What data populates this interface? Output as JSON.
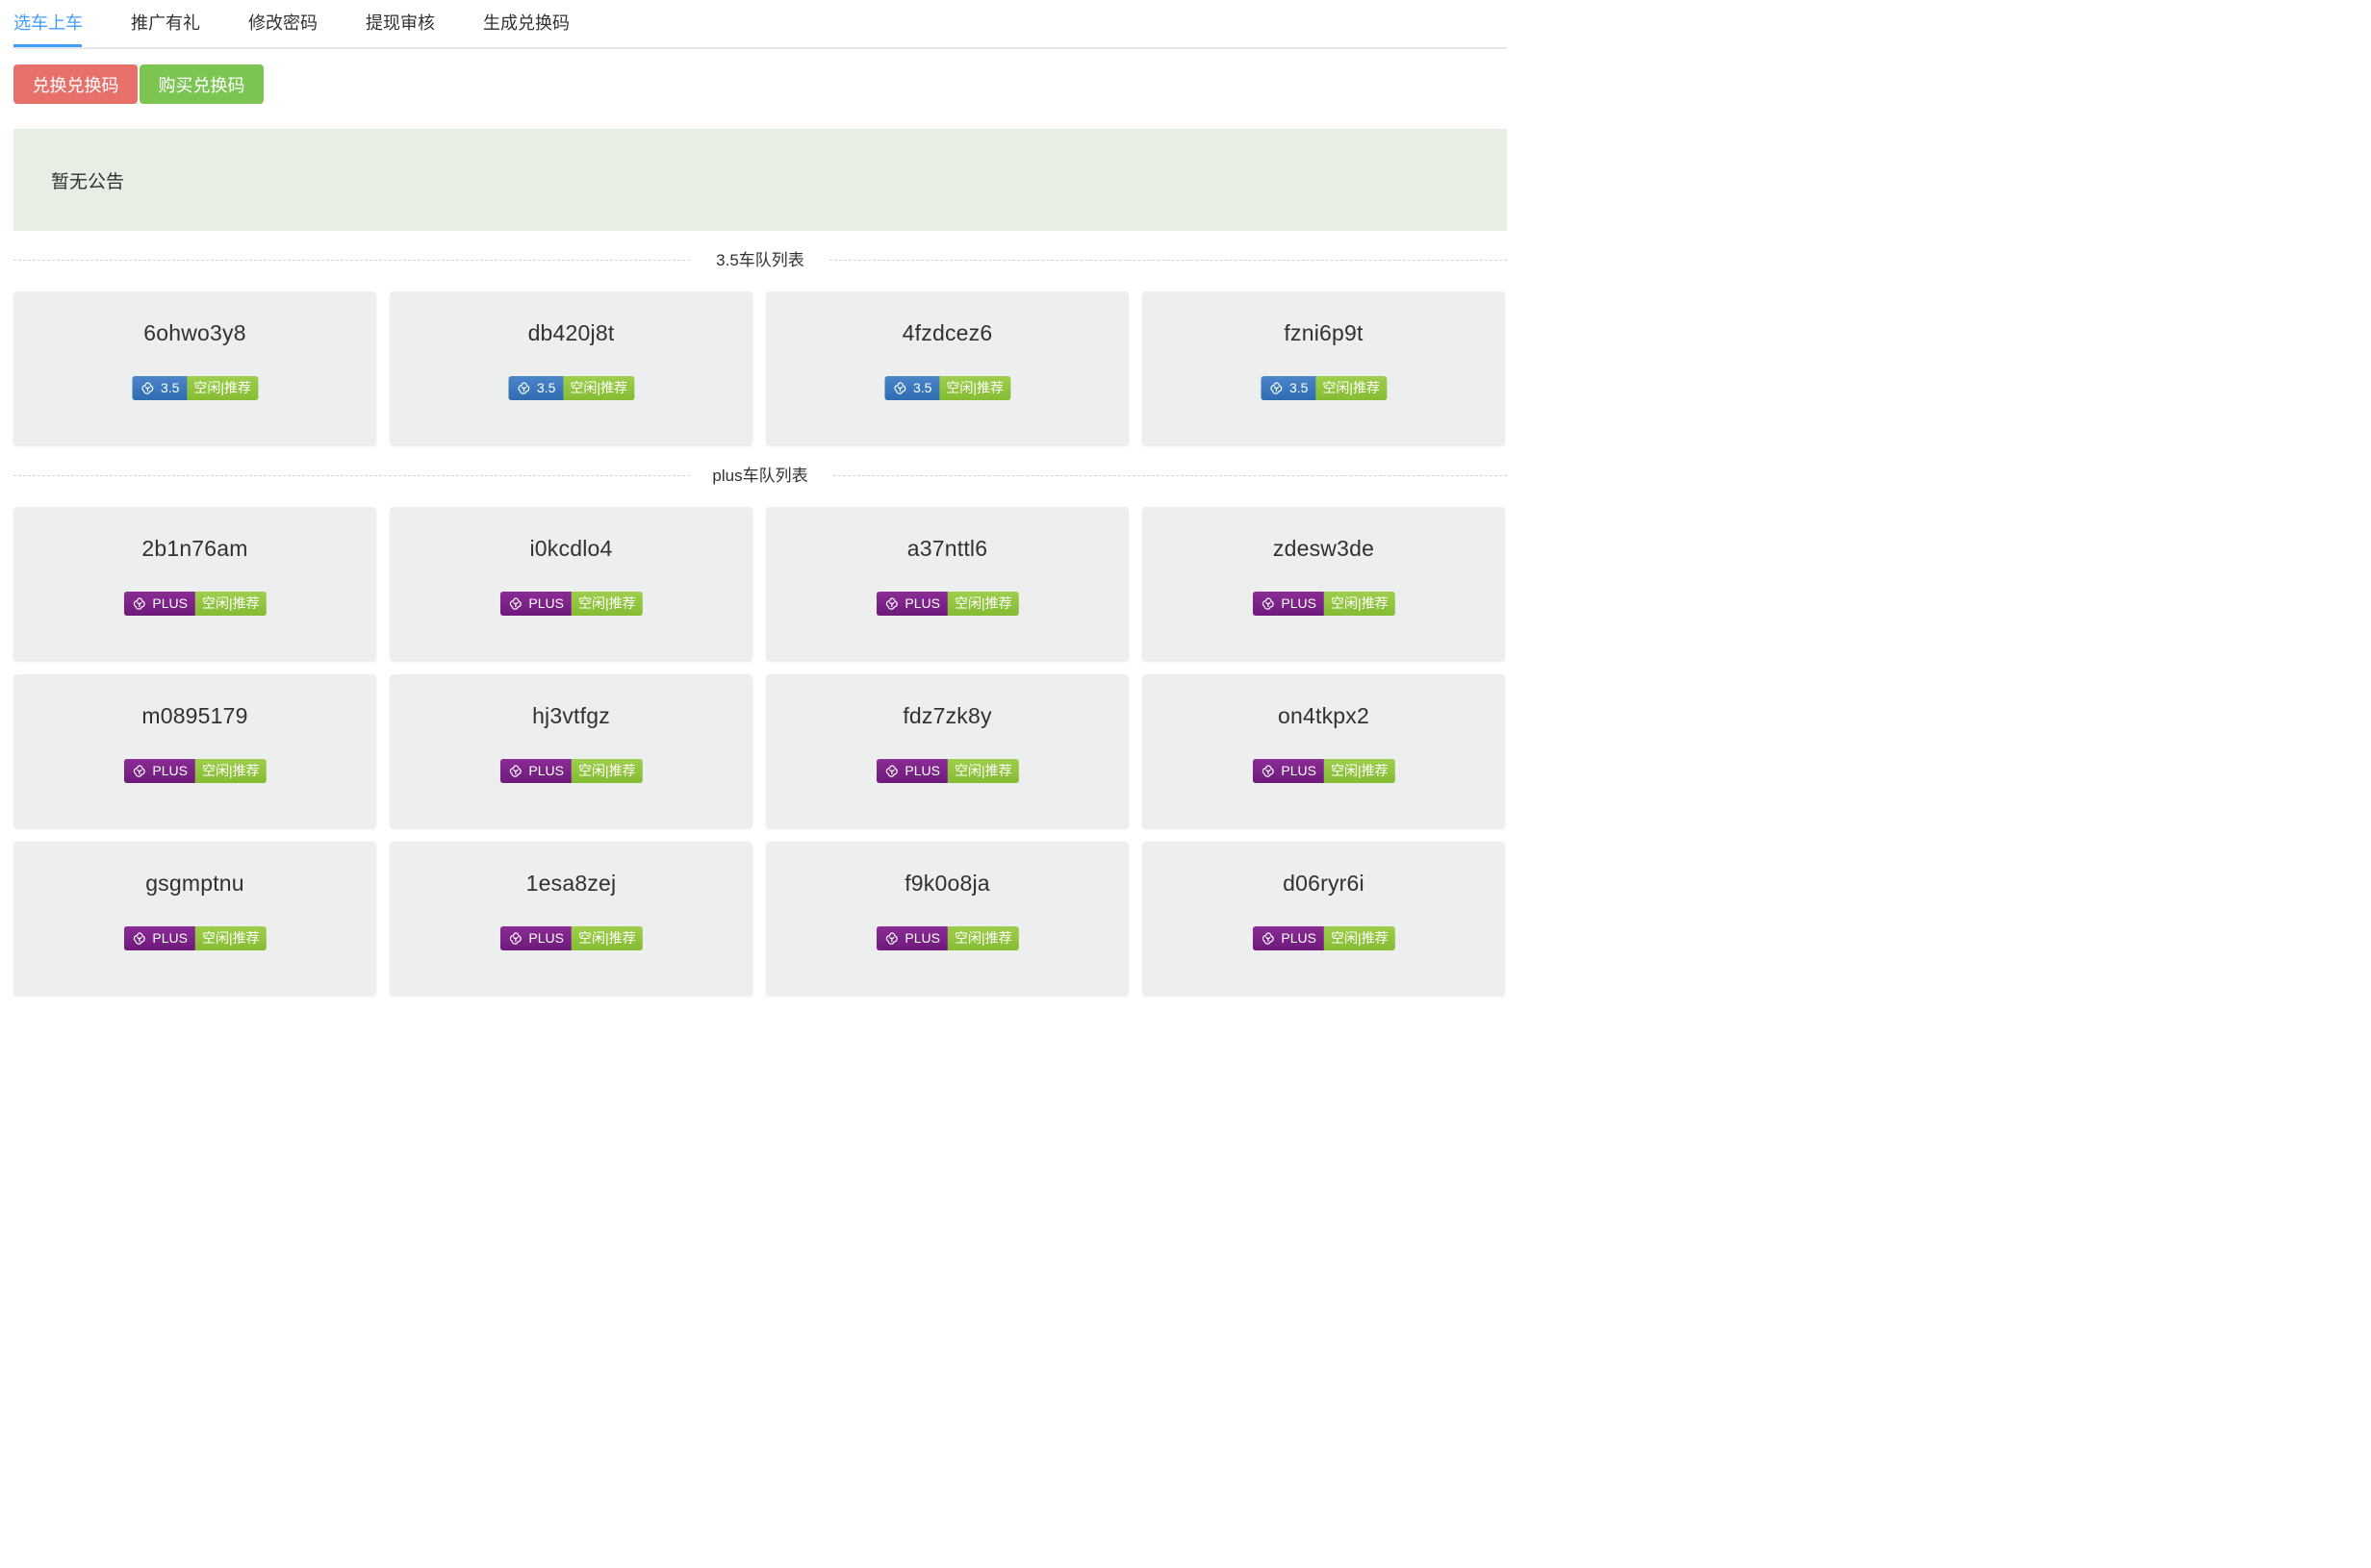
{
  "tabs": [
    "选车上车",
    "推广有礼",
    "修改密码",
    "提现审核",
    "生成兑换码"
  ],
  "buttons": {
    "redeem": "兑换兑换码",
    "buy": "购买兑换码"
  },
  "notice": "暂无公告",
  "colors": {
    "accent": "#409eff",
    "redeem_button": "#e8706b",
    "buy_button": "#7cc552",
    "badge_35": "#3a7abf",
    "badge_plus": "#7b2385",
    "badge_status": "#8dc43d"
  },
  "sections": {
    "gpt35": {
      "title": "3.5车队列表",
      "cards": [
        {
          "name": "6ohwo3y8",
          "model": "3.5",
          "status": "空闲|推荐",
          "icon": "openai-logo-icon"
        },
        {
          "name": "db420j8t",
          "model": "3.5",
          "status": "空闲|推荐",
          "icon": "openai-logo-icon"
        },
        {
          "name": "4fzdcez6",
          "model": "3.5",
          "status": "空闲|推荐",
          "icon": "openai-logo-icon"
        },
        {
          "name": "fzni6p9t",
          "model": "3.5",
          "status": "空闲|推荐",
          "icon": "openai-logo-icon"
        }
      ]
    },
    "plus": {
      "title": "plus车队列表",
      "cards": [
        {
          "name": "2b1n76am",
          "model": "PLUS",
          "status": "空闲|推荐",
          "icon": "openai-logo-icon"
        },
        {
          "name": "i0kcdlo4",
          "model": "PLUS",
          "status": "空闲|推荐",
          "icon": "openai-logo-icon"
        },
        {
          "name": "a37nttl6",
          "model": "PLUS",
          "status": "空闲|推荐",
          "icon": "openai-logo-icon"
        },
        {
          "name": "zdesw3de",
          "model": "PLUS",
          "status": "空闲|推荐",
          "icon": "openai-logo-icon"
        },
        {
          "name": "m0895179",
          "model": "PLUS",
          "status": "空闲|推荐",
          "icon": "openai-logo-icon"
        },
        {
          "name": "hj3vtfgz",
          "model": "PLUS",
          "status": "空闲|推荐",
          "icon": "openai-logo-icon"
        },
        {
          "name": "fdz7zk8y",
          "model": "PLUS",
          "status": "空闲|推荐",
          "icon": "openai-logo-icon"
        },
        {
          "name": "on4tkpx2",
          "model": "PLUS",
          "status": "空闲|推荐",
          "icon": "openai-logo-icon"
        },
        {
          "name": "gsgmptnu",
          "model": "PLUS",
          "status": "空闲|推荐",
          "icon": "openai-logo-icon"
        },
        {
          "name": "1esa8zej",
          "model": "PLUS",
          "status": "空闲|推荐",
          "icon": "openai-logo-icon"
        },
        {
          "name": "f9k0o8ja",
          "model": "PLUS",
          "status": "空闲|推荐",
          "icon": "openai-logo-icon"
        },
        {
          "name": "d06ryr6i",
          "model": "PLUS",
          "status": "空闲|推荐",
          "icon": "openai-logo-icon"
        }
      ]
    }
  }
}
